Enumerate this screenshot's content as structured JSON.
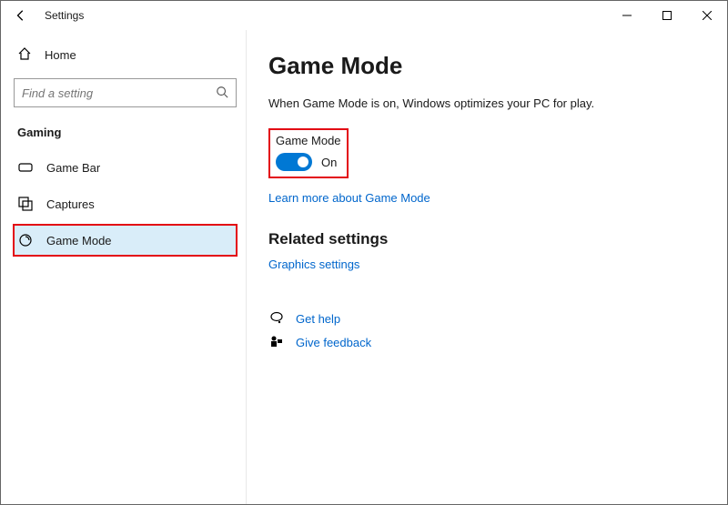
{
  "app": {
    "title": "Settings"
  },
  "sidebar": {
    "home_label": "Home",
    "search_placeholder": "Find a setting",
    "category": "Gaming",
    "items": [
      {
        "label": "Game Bar"
      },
      {
        "label": "Captures"
      },
      {
        "label": "Game Mode"
      }
    ]
  },
  "page": {
    "title": "Game Mode",
    "description": "When Game Mode is on, Windows optimizes your PC for play.",
    "toggle_label": "Game Mode",
    "toggle_state": "On",
    "learn_more": "Learn more about Game Mode",
    "related_header": "Related settings",
    "graphics_link": "Graphics settings",
    "get_help": "Get help",
    "give_feedback": "Give feedback"
  }
}
